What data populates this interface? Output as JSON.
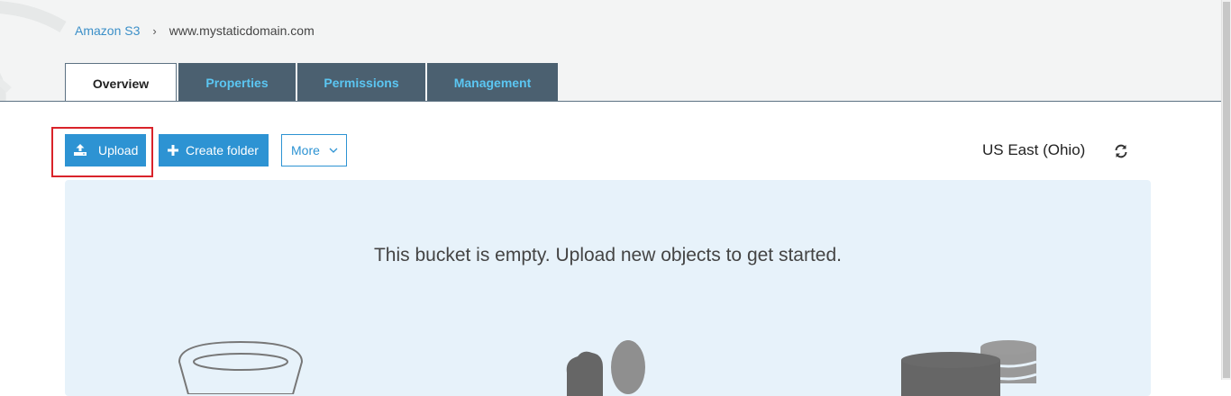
{
  "breadcrumb": {
    "root": "Amazon S3",
    "separator": "›",
    "current": "www.mystaticdomain.com"
  },
  "tabs": [
    {
      "label": "Overview",
      "active": true
    },
    {
      "label": "Properties",
      "active": false
    },
    {
      "label": "Permissions",
      "active": false
    },
    {
      "label": "Management",
      "active": false
    }
  ],
  "toolbar": {
    "upload_label": "Upload",
    "create_folder_label": "Create folder",
    "more_label": "More"
  },
  "region": "US East (Ohio)",
  "empty_state": {
    "message": "This bucket is empty. Upload new objects to get started."
  },
  "colors": {
    "primary": "#2d93d3",
    "tab_bg": "#4b6070",
    "tab_text": "#5bc6f2",
    "highlight": "#d9232a",
    "panel_bg": "#e7f2fa"
  },
  "icons": [
    "upload-icon",
    "plus-icon",
    "chevron-down-icon",
    "refresh-icon",
    "bucket-illustration",
    "people-illustration",
    "database-illustration"
  ]
}
